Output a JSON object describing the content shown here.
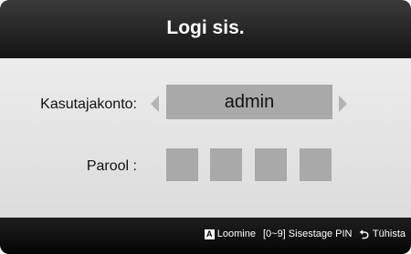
{
  "dialog": {
    "title": "Logi sis."
  },
  "login": {
    "username_label": "Kasutajakonto:",
    "username_value": "admin",
    "password_label": "Parool :",
    "pin_boxes": [
      "",
      "",
      "",
      ""
    ]
  },
  "footer": {
    "key_a_glyph": "A",
    "create_label": "Loomine",
    "pin_hint": "[0~9] Sisestage PIN",
    "return_label": "Tühista",
    "icons": [
      "a-key-icon",
      "return-icon"
    ]
  }
}
